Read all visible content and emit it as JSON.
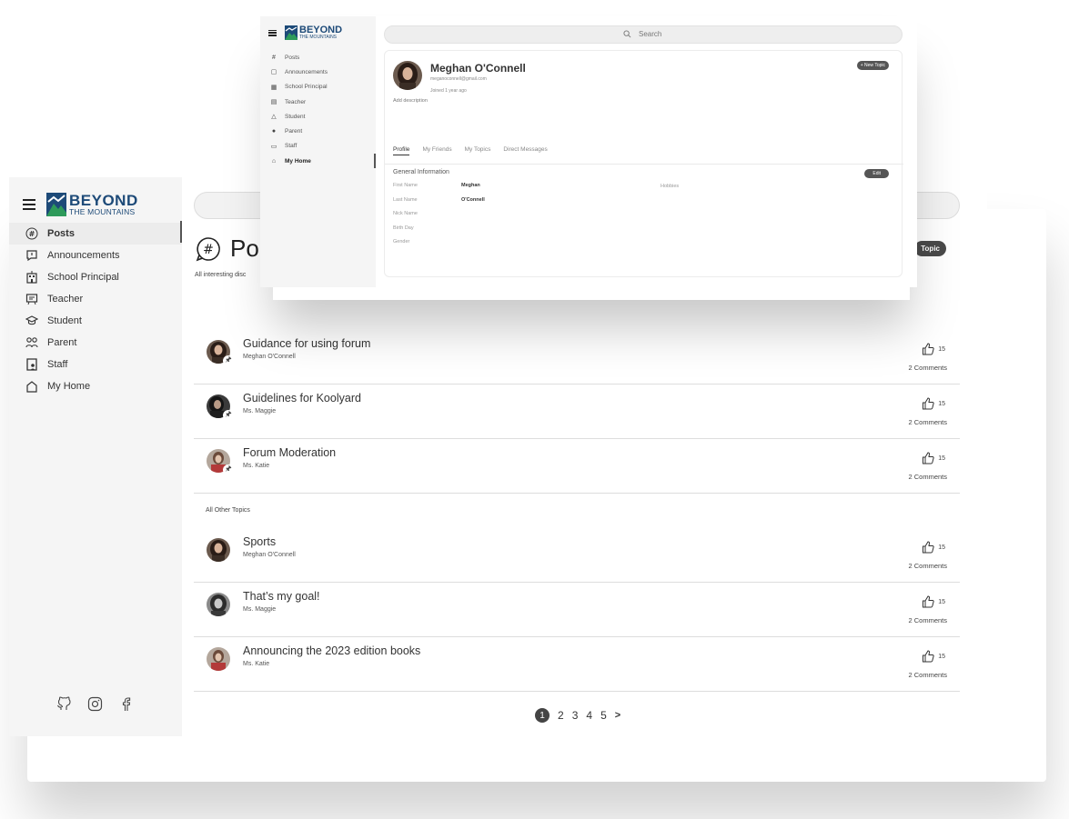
{
  "main": {
    "logo": {
      "big": "BEYOND",
      "small": "THE MOUNTAINS"
    },
    "nav": [
      {
        "label": "Posts",
        "icon": "hashtag-icon",
        "active": true
      },
      {
        "label": "Announcements",
        "icon": "announcement-icon"
      },
      {
        "label": "School Principal",
        "icon": "school-icon"
      },
      {
        "label": "Teacher",
        "icon": "teacher-icon"
      },
      {
        "label": "Student",
        "icon": "graduation-cap-icon"
      },
      {
        "label": "Parent",
        "icon": "parent-icon"
      },
      {
        "label": "Staff",
        "icon": "staff-badge-icon"
      },
      {
        "label": "My Home",
        "icon": "home-icon"
      }
    ],
    "page_title": "Po",
    "page_subtitle": "All interesting disc",
    "new_topic_label": "Topic",
    "pinned_topics": [
      {
        "title": "Guidance for using forum",
        "author": "Meghan O'Connell",
        "likes": "15",
        "comments": "2 Comments"
      },
      {
        "title": "Guidelines for Koolyard",
        "author": "Ms. Maggie",
        "likes": "15",
        "comments": "2 Comments"
      },
      {
        "title": "Forum Moderation",
        "author": "Ms. Katie",
        "likes": "15",
        "comments": "2 Comments"
      }
    ],
    "other_topics_label": "All Other Topics",
    "other_topics": [
      {
        "title": "Sports",
        "author": "Meghan O'Connell",
        "likes": "15",
        "comments": "2 Comments"
      },
      {
        "title": "That’s my goal!",
        "author": "Ms. Maggie",
        "likes": "15",
        "comments": "2 Comments"
      },
      {
        "title": "Announcing the 2023 edition books",
        "author": "Ms. Katie",
        "likes": "15",
        "comments": "2 Comments"
      }
    ],
    "pagination": {
      "pages": [
        "1",
        "2",
        "3",
        "4",
        "5"
      ],
      "current": "1",
      "next": ">"
    },
    "socials": [
      "github-icon",
      "instagram-icon",
      "facebook-icon"
    ]
  },
  "overlay": {
    "logo": {
      "big": "BEYOND",
      "small": "THE MOUNTAINS"
    },
    "nav": [
      {
        "label": "Posts"
      },
      {
        "label": "Announcements"
      },
      {
        "label": "School Principal"
      },
      {
        "label": "Teacher"
      },
      {
        "label": "Student"
      },
      {
        "label": "Parent"
      },
      {
        "label": "Staff"
      },
      {
        "label": "My Home",
        "active": true
      }
    ],
    "search_placeholder": "Search",
    "profile": {
      "name": "Meghan O'Connell",
      "email": "meganoconnell@gmail.com",
      "joined": "Joined 1 year ago",
      "description": "Add description",
      "new_topic_label": "+ New Topic",
      "tabs": [
        "Profile",
        "My Friends",
        "My Topics",
        "Direct Messages"
      ],
      "section_title": "General Information",
      "edit_label": "Edit",
      "fields": [
        {
          "key": "First Name",
          "value": "Meghan"
        },
        {
          "key": "Last Name",
          "value": "O'Connell"
        },
        {
          "key": "Nick Name",
          "value": ""
        },
        {
          "key": "Birth Day",
          "value": ""
        },
        {
          "key": "Gender",
          "value": ""
        }
      ],
      "hobbies_label": "Hobbies"
    }
  },
  "colors": {
    "brand": "#1d4a78",
    "brand_green": "#2e9a5a",
    "dark_button": "#4a4a4a"
  }
}
